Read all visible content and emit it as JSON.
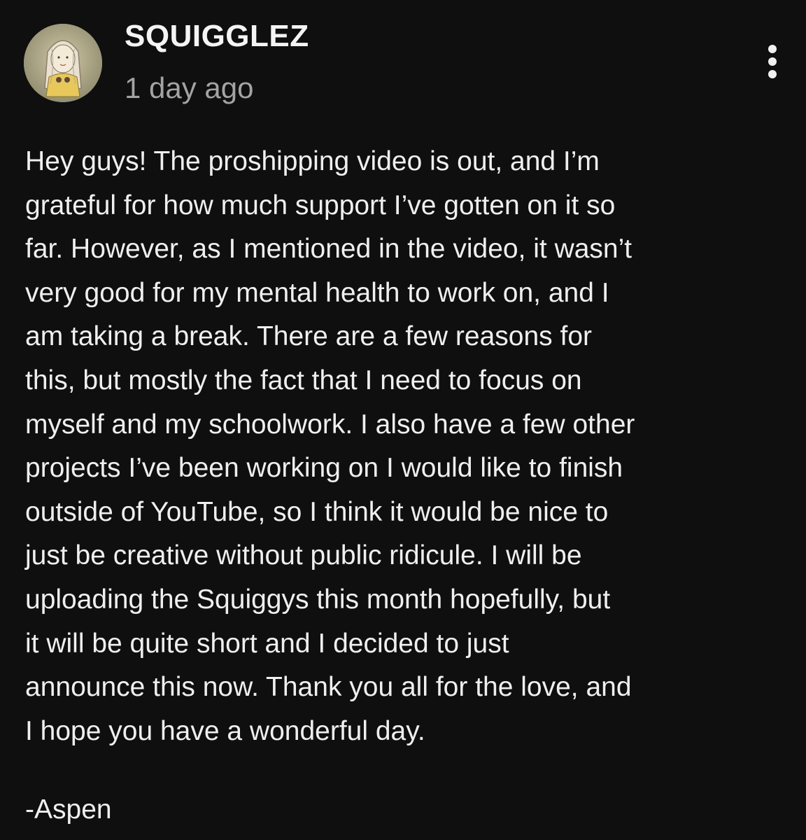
{
  "comment": {
    "author": "SQUIGGLEZ",
    "timestamp": "1 day ago",
    "avatar_icon": "user-avatar-drawing",
    "menu_icon": "more-vertical-icon",
    "body_lines": [
      "Hey guys! The proshipping video is out, and I’m",
      "grateful for how much support I’ve gotten on it so",
      "far. However, as I mentioned in the video, it wasn’t",
      "very good for my mental health to work on, and I",
      "am taking a break. There are a few reasons for",
      "this, but mostly the fact that I need to focus on",
      "myself and my schoolwork. I also have a few other",
      "projects I’ve been working on I would like to finish",
      "outside of YouTube, so I think it would be nice to",
      "just be creative without public ridicule. I will be",
      "uploading the Squiggys this month hopefully, but",
      "it will be quite short and I decided to just",
      "announce this now. Thank you all for the love, and",
      "I hope you have a wonderful day."
    ],
    "signature": "-Aspen"
  },
  "colors": {
    "background": "#0f0f0f",
    "text": "#efefef",
    "secondary_text": "#a3a3a3"
  }
}
